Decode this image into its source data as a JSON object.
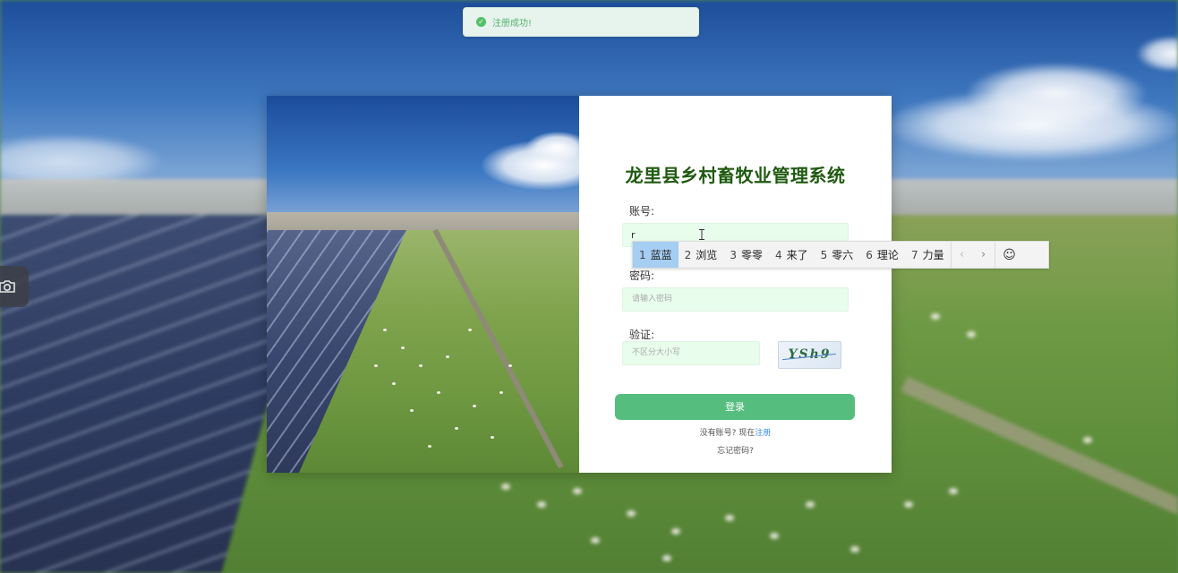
{
  "toast": {
    "message": "注册成功!",
    "icon": "check-circle-icon",
    "color": "#56b36f"
  },
  "side_button": {
    "icon": "camera-icon"
  },
  "login": {
    "title": "龙里县乡村畜牧业管理系统",
    "account_label": "账号:",
    "account_value": "r",
    "password_label": "密码:",
    "password_placeholder": "请输入密码",
    "captcha_label": "验证:",
    "captcha_placeholder": "不区分大小写",
    "captcha_text": "YSh9",
    "login_button": "登录",
    "no_account_text": "没有账号? 现在",
    "register_link": "注册",
    "forgot_text": "忘记密码?",
    "accent_color": "#55be7f",
    "title_color": "#1f5a10"
  },
  "ime": {
    "candidates": [
      {
        "num": "1",
        "text": "蓝蓝"
      },
      {
        "num": "2",
        "text": "浏览"
      },
      {
        "num": "3",
        "text": "零零"
      },
      {
        "num": "4",
        "text": "来了"
      },
      {
        "num": "5",
        "text": "零六"
      },
      {
        "num": "6",
        "text": "理论"
      },
      {
        "num": "7",
        "text": "力量"
      }
    ],
    "prev_icon": "chevron-left-icon",
    "next_icon": "chevron-right-icon",
    "emoji_icon": "smiley-icon"
  }
}
